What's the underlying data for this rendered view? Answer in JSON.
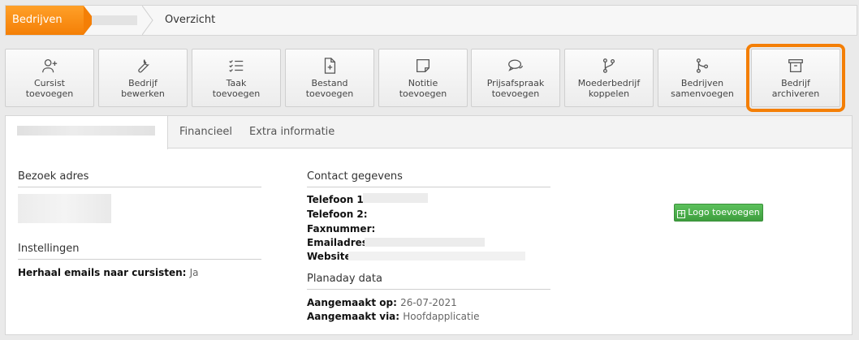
{
  "breadcrumb": {
    "home": "Bedrijven",
    "current": "Overzicht"
  },
  "toolbar": [
    {
      "line1": "Cursist",
      "line2": "toevoegen",
      "icon": "user-plus-icon"
    },
    {
      "line1": "Bedrijf",
      "line2": "bewerken",
      "icon": "wrench-icon"
    },
    {
      "line1": "Taak",
      "line2": "toevoegen",
      "icon": "checklist-icon"
    },
    {
      "line1": "Bestand",
      "line2": "toevoegen",
      "icon": "file-plus-icon"
    },
    {
      "line1": "Notitie",
      "line2": "toevoegen",
      "icon": "sticky-note-icon"
    },
    {
      "line1": "Prijsafspraak",
      "line2": "toevoegen",
      "icon": "chat-bubbles-icon"
    },
    {
      "line1": "Moederbedrijf",
      "line2": "koppelen",
      "icon": "git-branch-icon"
    },
    {
      "line1": "Bedrijven",
      "line2": "samenvoegen",
      "icon": "git-merge-icon"
    },
    {
      "line1": "Bedrijf",
      "line2": "archiveren",
      "icon": "archive-icon"
    }
  ],
  "tabs": [
    "Financieel",
    "Extra informatie"
  ],
  "left": {
    "visit_heading": "Bezoek adres",
    "settings_heading": "Instellingen",
    "repeat_label": "Herhaal emails naar cursisten:",
    "repeat_value": "Ja"
  },
  "contact": {
    "heading": "Contact gegevens",
    "phone1": "Telefoon 1:",
    "phone2": "Telefoon 2:",
    "fax": "Faxnummer:",
    "email": "Emailadres:",
    "website": "Website:"
  },
  "planaday": {
    "heading": "Planaday data",
    "created_on_label": "Aangemaakt op:",
    "created_on_value": "26-07-2021",
    "created_via_label": "Aangemaakt via:",
    "created_via_value": "Hoofdapplicatie"
  },
  "logo_button": "Logo toevoegen"
}
